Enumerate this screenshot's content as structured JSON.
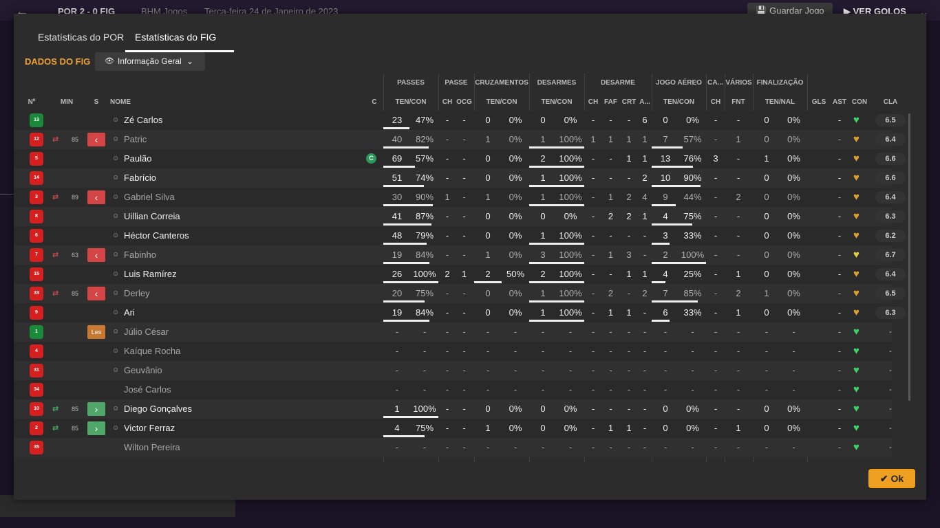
{
  "background": {
    "back_icon": "arrow-left-icon",
    "score_line": "POR  2 - 0  FIG",
    "team_label": "BHM Jogos",
    "date": "Terça-feira 24 de Janeiro de 2023",
    "save_button": "Guardar Jogo",
    "play_button": "VER GOLOS"
  },
  "tabs": [
    "Estatísticas do POR",
    "Estatísticas do FIG"
  ],
  "section_title": "DADOS DO FIG",
  "dropdown": {
    "label": "Informação Geral",
    "icon": "eye-icon"
  },
  "group_headers": [
    "PASSES",
    "PASSE",
    "CRUZAMENTOS",
    "DESARMES",
    "DESARME",
    "JOGO AÉREO",
    "CA...",
    "VÁRIOS",
    "FINALIZAÇÃO"
  ],
  "columns": [
    "Nº",
    "MIN",
    "S",
    "NOME",
    "C",
    "TEN/CON",
    "CH",
    "OCG",
    "TEN/CON",
    "TEN/CON",
    "CH",
    "FAF",
    "CRT",
    "A...",
    "TEN/CON",
    "CH",
    "FNT",
    "TEN/NAL",
    "GLS",
    "AST",
    "CON",
    "CLA"
  ],
  "players": [
    {
      "num": "13",
      "kit": "green",
      "swap": "",
      "min": "",
      "sub": "",
      "name": "Zé Carlos",
      "dim": false,
      "icon": true,
      "capt": "",
      "p1": "23",
      "p2": "47%",
      "pb": 0.47,
      "ch": "-",
      "ocg": "-",
      "cr1": "0",
      "cr2": "0%",
      "cb": 0,
      "d1": "0",
      "d2": "0%",
      "db": 0,
      "dch": "-",
      "faf": "-",
      "crt": "-",
      "a": "6",
      "j1": "0",
      "j2": "0%",
      "jb": 0,
      "ca": "-",
      "fnt": "-",
      "f1": "0",
      "f2": "0%",
      "gls": "",
      "ast": "-",
      "con": "#3ad36a",
      "cla": "6.5"
    },
    {
      "num": "12",
      "kit": "red",
      "swap": "out",
      "min": "85",
      "sub": "out",
      "name": "Patric",
      "dim": true,
      "icon": true,
      "capt": "",
      "p1": "40",
      "p2": "82%",
      "pb": 0.82,
      "ch": "-",
      "ocg": "-",
      "cr1": "1",
      "cr2": "0%",
      "cb": 0,
      "d1": "1",
      "d2": "100%",
      "db": 1,
      "dch": "1",
      "faf": "1",
      "crt": "1",
      "a": "1",
      "j1": "7",
      "j2": "57%",
      "jb": 0.57,
      "ca": "-",
      "fnt": "1",
      "f1": "0",
      "f2": "0%",
      "gls": "",
      "ast": "-",
      "con": "#e0a030",
      "cla": "6.4"
    },
    {
      "num": "5",
      "kit": "red",
      "swap": "",
      "min": "",
      "sub": "",
      "name": "Paulão",
      "dim": false,
      "icon": true,
      "capt": "C",
      "p1": "69",
      "p2": "57%",
      "pb": 0.57,
      "ch": "-",
      "ocg": "-",
      "cr1": "0",
      "cr2": "0%",
      "cb": 0,
      "d1": "2",
      "d2": "100%",
      "db": 1,
      "dch": "-",
      "faf": "-",
      "crt": "1",
      "a": "1",
      "j1": "13",
      "j2": "76%",
      "jb": 0.76,
      "ca": "3",
      "fnt": "-",
      "f1": "1",
      "f2": "0%",
      "gls": "",
      "ast": "-",
      "con": "#e0a030",
      "cla": "6.6"
    },
    {
      "num": "14",
      "kit": "red",
      "swap": "",
      "min": "",
      "sub": "",
      "name": "Fabrício",
      "dim": false,
      "icon": true,
      "capt": "",
      "p1": "51",
      "p2": "74%",
      "pb": 0.74,
      "ch": "-",
      "ocg": "-",
      "cr1": "0",
      "cr2": "0%",
      "cb": 0,
      "d1": "1",
      "d2": "100%",
      "db": 1,
      "dch": "-",
      "faf": "-",
      "crt": "-",
      "a": "2",
      "j1": "10",
      "j2": "90%",
      "jb": 0.9,
      "ca": "-",
      "fnt": "-",
      "f1": "0",
      "f2": "0%",
      "gls": "",
      "ast": "-",
      "con": "#e0a030",
      "cla": "6.6"
    },
    {
      "num": "3",
      "kit": "red",
      "swap": "out",
      "min": "89",
      "sub": "out",
      "name": "Gabriel Silva",
      "dim": true,
      "icon": true,
      "capt": "",
      "p1": "30",
      "p2": "90%",
      "pb": 0.9,
      "ch": "1",
      "ocg": "-",
      "cr1": "1",
      "cr2": "0%",
      "cb": 0,
      "d1": "1",
      "d2": "100%",
      "db": 1,
      "dch": "-",
      "faf": "1",
      "crt": "2",
      "a": "4",
      "j1": "9",
      "j2": "44%",
      "jb": 0.44,
      "ca": "-",
      "fnt": "2",
      "f1": "0",
      "f2": "0%",
      "gls": "",
      "ast": "-",
      "con": "#e0a030",
      "cla": "6.4"
    },
    {
      "num": "8",
      "kit": "red",
      "swap": "",
      "min": "",
      "sub": "",
      "name": "Uillian Correia",
      "dim": false,
      "icon": true,
      "capt": "",
      "p1": "41",
      "p2": "87%",
      "pb": 0.87,
      "ch": "-",
      "ocg": "-",
      "cr1": "0",
      "cr2": "0%",
      "cb": 0,
      "d1": "0",
      "d2": "0%",
      "db": 0,
      "dch": "-",
      "faf": "2",
      "crt": "2",
      "a": "1",
      "j1": "4",
      "j2": "75%",
      "jb": 0.75,
      "ca": "-",
      "fnt": "-",
      "f1": "0",
      "f2": "0%",
      "gls": "",
      "ast": "-",
      "con": "#e0a030",
      "cla": "6.3"
    },
    {
      "num": "6",
      "kit": "red",
      "swap": "",
      "min": "",
      "sub": "",
      "name": "Héctor Canteros",
      "dim": false,
      "icon": true,
      "capt": "",
      "p1": "48",
      "p2": "79%",
      "pb": 0.79,
      "ch": "-",
      "ocg": "-",
      "cr1": "0",
      "cr2": "0%",
      "cb": 0,
      "d1": "1",
      "d2": "100%",
      "db": 1,
      "dch": "-",
      "faf": "-",
      "crt": "-",
      "a": "-",
      "j1": "3",
      "j2": "33%",
      "jb": 0.33,
      "ca": "-",
      "fnt": "-",
      "f1": "0",
      "f2": "0%",
      "gls": "",
      "ast": "-",
      "con": "#e0a030",
      "cla": "6.2"
    },
    {
      "num": "7",
      "kit": "red",
      "swap": "out",
      "min": "63",
      "sub": "out",
      "name": "Fabinho",
      "dim": true,
      "icon": true,
      "capt": "",
      "p1": "19",
      "p2": "84%",
      "pb": 0.84,
      "ch": "-",
      "ocg": "-",
      "cr1": "1",
      "cr2": "0%",
      "cb": 0,
      "d1": "3",
      "d2": "100%",
      "db": 1,
      "dch": "-",
      "faf": "1",
      "crt": "3",
      "a": "-",
      "j1": "2",
      "j2": "100%",
      "jb": 1,
      "ca": "-",
      "fnt": "-",
      "f1": "0",
      "f2": "0%",
      "gls": "",
      "ast": "-",
      "con": "#e8d040",
      "cla": "6.7"
    },
    {
      "num": "15",
      "kit": "red",
      "swap": "",
      "min": "",
      "sub": "",
      "name": "Luis Ramírez",
      "dim": false,
      "icon": true,
      "capt": "",
      "p1": "26",
      "p2": "100%",
      "pb": 1,
      "ch": "2",
      "ocg": "1",
      "cr1": "2",
      "cr2": "50%",
      "cb": 0.5,
      "d1": "2",
      "d2": "100%",
      "db": 1,
      "dch": "-",
      "faf": "-",
      "crt": "1",
      "a": "1",
      "j1": "4",
      "j2": "25%",
      "jb": 0.25,
      "ca": "-",
      "fnt": "1",
      "f1": "0",
      "f2": "0%",
      "gls": "",
      "ast": "-",
      "con": "#e0a030",
      "cla": "6.4"
    },
    {
      "num": "33",
      "kit": "red",
      "swap": "out",
      "min": "85",
      "sub": "out",
      "name": "Derley",
      "dim": true,
      "icon": true,
      "capt": "",
      "p1": "20",
      "p2": "75%",
      "pb": 0.75,
      "ch": "-",
      "ocg": "-",
      "cr1": "0",
      "cr2": "0%",
      "cb": 0,
      "d1": "1",
      "d2": "100%",
      "db": 1,
      "dch": "-",
      "faf": "2",
      "crt": "-",
      "a": "2",
      "j1": "7",
      "j2": "85%",
      "jb": 0.85,
      "ca": "-",
      "fnt": "2",
      "f1": "1",
      "f2": "0%",
      "gls": "",
      "ast": "-",
      "con": "#e0a030",
      "cla": "6.5"
    },
    {
      "num": "9",
      "kit": "red",
      "swap": "",
      "min": "",
      "sub": "",
      "name": "Ari",
      "dim": false,
      "icon": true,
      "capt": "",
      "p1": "19",
      "p2": "84%",
      "pb": 0.84,
      "ch": "-",
      "ocg": "-",
      "cr1": "0",
      "cr2": "0%",
      "cb": 0,
      "d1": "1",
      "d2": "100%",
      "db": 1,
      "dch": "-",
      "faf": "1",
      "crt": "1",
      "a": "-",
      "j1": "6",
      "j2": "33%",
      "jb": 0.33,
      "ca": "-",
      "fnt": "1",
      "f1": "0",
      "f2": "0%",
      "gls": "",
      "ast": "-",
      "con": "#e0a030",
      "cla": "6.3"
    },
    {
      "num": "1",
      "kit": "green",
      "swap": "",
      "min": "",
      "sub": "les",
      "subLabel": "Les",
      "name": "Júlio César",
      "dim": true,
      "icon": true,
      "capt": "",
      "p1": "-",
      "p2": "-",
      "pb": 0,
      "ch": "-",
      "ocg": "-",
      "cr1": "-",
      "cr2": "-",
      "cb": 0,
      "d1": "-",
      "d2": "-",
      "db": 0,
      "dch": "-",
      "faf": "-",
      "crt": "-",
      "a": "-",
      "j1": "-",
      "j2": "-",
      "jb": 0,
      "ca": "-",
      "fnt": "-",
      "f1": "-",
      "f2": "-",
      "gls": "",
      "ast": "-",
      "con": "#3ad36a",
      "cla": "-"
    },
    {
      "num": "4",
      "kit": "red",
      "swap": "",
      "min": "",
      "sub": "",
      "name": "Kaíque Rocha",
      "dim": true,
      "icon": true,
      "capt": "",
      "p1": "-",
      "p2": "-",
      "pb": 0,
      "ch": "-",
      "ocg": "-",
      "cr1": "-",
      "cr2": "-",
      "cb": 0,
      "d1": "-",
      "d2": "-",
      "db": 0,
      "dch": "-",
      "faf": "-",
      "crt": "-",
      "a": "-",
      "j1": "-",
      "j2": "-",
      "jb": 0,
      "ca": "-",
      "fnt": "-",
      "f1": "-",
      "f2": "-",
      "gls": "",
      "ast": "-",
      "con": "#3ad36a",
      "cla": "-"
    },
    {
      "num": "31",
      "kit": "red",
      "swap": "",
      "min": "",
      "sub": "",
      "name": "Geuvânio",
      "dim": true,
      "icon": true,
      "capt": "",
      "p1": "-",
      "p2": "-",
      "pb": 0,
      "ch": "-",
      "ocg": "-",
      "cr1": "-",
      "cr2": "-",
      "cb": 0,
      "d1": "-",
      "d2": "-",
      "db": 0,
      "dch": "-",
      "faf": "-",
      "crt": "-",
      "a": "-",
      "j1": "-",
      "j2": "-",
      "jb": 0,
      "ca": "-",
      "fnt": "-",
      "f1": "-",
      "f2": "-",
      "gls": "",
      "ast": "-",
      "con": "#3ad36a",
      "cla": "-"
    },
    {
      "num": "34",
      "kit": "red",
      "swap": "",
      "min": "",
      "sub": "",
      "name": "José Carlos",
      "dim": true,
      "icon": false,
      "capt": "",
      "p1": "-",
      "p2": "-",
      "pb": 0,
      "ch": "-",
      "ocg": "-",
      "cr1": "-",
      "cr2": "-",
      "cb": 0,
      "d1": "-",
      "d2": "-",
      "db": 0,
      "dch": "-",
      "faf": "-",
      "crt": "-",
      "a": "-",
      "j1": "-",
      "j2": "-",
      "jb": 0,
      "ca": "-",
      "fnt": "-",
      "f1": "-",
      "f2": "-",
      "gls": "",
      "ast": "-",
      "con": "#3ad36a",
      "cla": "-"
    },
    {
      "num": "10",
      "kit": "red",
      "swap": "in",
      "min": "85",
      "sub": "in",
      "name": "Diego Gonçalves",
      "dim": false,
      "icon": true,
      "capt": "",
      "p1": "1",
      "p2": "100%",
      "pb": 1,
      "ch": "-",
      "ocg": "-",
      "cr1": "0",
      "cr2": "0%",
      "cb": 0,
      "d1": "0",
      "d2": "0%",
      "db": 0,
      "dch": "-",
      "faf": "-",
      "crt": "-",
      "a": "-",
      "j1": "0",
      "j2": "0%",
      "jb": 0,
      "ca": "-",
      "fnt": "-",
      "f1": "0",
      "f2": "0%",
      "gls": "",
      "ast": "-",
      "con": "#3ad36a",
      "cla": "-"
    },
    {
      "num": "2",
      "kit": "red",
      "swap": "in",
      "min": "85",
      "sub": "in",
      "name": "Victor Ferraz",
      "dim": false,
      "icon": true,
      "capt": "",
      "p1": "4",
      "p2": "75%",
      "pb": 0.75,
      "ch": "-",
      "ocg": "-",
      "cr1": "1",
      "cr2": "0%",
      "cb": 0,
      "d1": "0",
      "d2": "0%",
      "db": 0,
      "dch": "-",
      "faf": "1",
      "crt": "1",
      "a": "-",
      "j1": "0",
      "j2": "0%",
      "jb": 0,
      "ca": "-",
      "fnt": "1",
      "f1": "0",
      "f2": "0%",
      "gls": "",
      "ast": "-",
      "con": "#3ad36a",
      "cla": "-"
    },
    {
      "num": "35",
      "kit": "red",
      "swap": "",
      "min": "",
      "sub": "",
      "name": "Wilton Pereira",
      "dim": true,
      "icon": false,
      "capt": "",
      "p1": "-",
      "p2": "-",
      "pb": 0,
      "ch": "-",
      "ocg": "-",
      "cr1": "-",
      "cr2": "-",
      "cb": 0,
      "d1": "-",
      "d2": "-",
      "db": 0,
      "dch": "-",
      "faf": "-",
      "crt": "-",
      "a": "-",
      "j1": "-",
      "j2": "-",
      "jb": 0,
      "ca": "-",
      "fnt": "-",
      "f1": "-",
      "f2": "-",
      "gls": "",
      "ast": "-",
      "con": "#3ad36a",
      "cla": "-"
    }
  ],
  "ok_button": "Ok",
  "colors": {
    "accent": "#f0a030",
    "sub_out": "#d64545",
    "sub_in": "#4fa86a",
    "kit_red": "#d62020",
    "kit_green": "#1a8a3a"
  }
}
